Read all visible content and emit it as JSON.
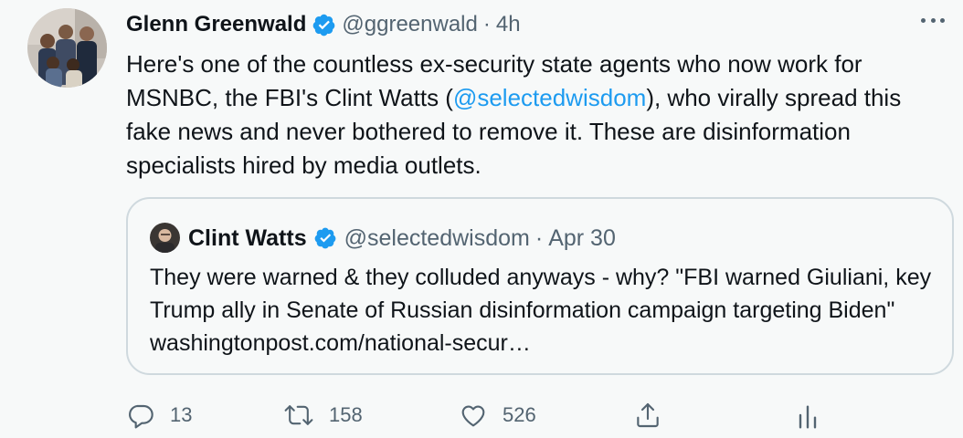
{
  "tweet": {
    "author_name": "Glenn Greenwald",
    "author_handle": "@ggreenwald",
    "separator": "·",
    "time": "4h",
    "text_part1": "Here's one of the countless ex-security state agents who now work for MSNBC, the FBI's Clint Watts (",
    "mention": "@selectedwisdom",
    "text_part2": "), who virally spread this fake news and never bothered to remove it. These are disinformation specialists hired by media outlets."
  },
  "quote": {
    "author_name": "Clint Watts",
    "author_handle": "@selectedwisdom",
    "separator": "·",
    "date": "Apr 30",
    "text": "They were warned & they colluded anyways - why? \"FBI warned Giuliani, key Trump ally in Senate of Russian disinformation campaign targeting Biden\" washingtonpost.com/national-secur…"
  },
  "actions": {
    "replies": "13",
    "retweets": "158",
    "likes": "526"
  },
  "icons": {
    "reply": "reply-icon",
    "retweet": "retweet-icon",
    "like": "heart-icon",
    "share": "share-icon",
    "analytics": "analytics-icon",
    "more": "more-icon",
    "verified": "verified-badge-icon"
  },
  "colors": {
    "background": "#f7f9f9",
    "text": "#0f1419",
    "secondary": "#536471",
    "link": "#1d9bf0",
    "border": "#cfd9de"
  }
}
